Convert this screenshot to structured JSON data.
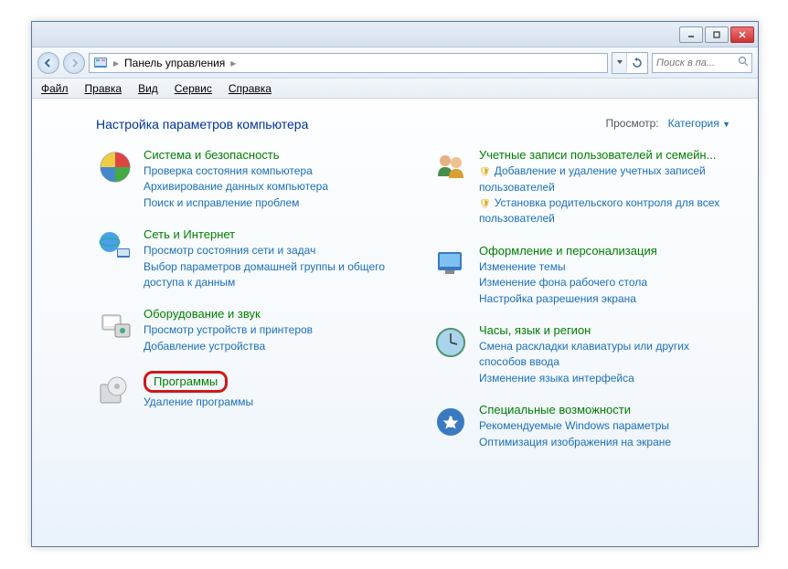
{
  "breadcrumb": {
    "root": "Панель управления"
  },
  "search": {
    "placeholder": "Поиск в па..."
  },
  "menu": {
    "file": "Файл",
    "edit": "Правка",
    "view": "Вид",
    "tools": "Сервис",
    "help": "Справка"
  },
  "heading": "Настройка параметров компьютера",
  "viewby": {
    "label": "Просмотр:",
    "value": "Категория"
  },
  "categories": {
    "left": [
      {
        "id": "system",
        "title": "Система и безопасность",
        "links": [
          {
            "t": "Проверка состояния компьютера"
          },
          {
            "t": "Архивирование данных компьютера"
          },
          {
            "t": "Поиск и исправление проблем"
          }
        ]
      },
      {
        "id": "network",
        "title": "Сеть и Интернет",
        "links": [
          {
            "t": "Просмотр состояния сети и задач"
          },
          {
            "t": "Выбор параметров домашней группы и общего доступа к данным"
          }
        ]
      },
      {
        "id": "hardware",
        "title": "Оборудование и звук",
        "links": [
          {
            "t": "Просмотр устройств и принтеров"
          },
          {
            "t": "Добавление устройства"
          }
        ]
      },
      {
        "id": "programs",
        "title": "Программы",
        "highlighted": true,
        "links": [
          {
            "t": "Удаление программы"
          }
        ]
      }
    ],
    "right": [
      {
        "id": "users",
        "title": "Учетные записи пользователей и семейн...",
        "links": [
          {
            "t": "Добавление и удаление учетных записей пользователей",
            "shield": true
          },
          {
            "t": "Установка родительского контроля для всех пользователей",
            "shield": true
          }
        ]
      },
      {
        "id": "appearance",
        "title": "Оформление и персонализация",
        "links": [
          {
            "t": "Изменение темы"
          },
          {
            "t": "Изменение фона рабочего стола"
          },
          {
            "t": "Настройка разрешения экрана"
          }
        ]
      },
      {
        "id": "clock",
        "title": "Часы, язык и регион",
        "links": [
          {
            "t": "Смена раскладки клавиатуры или других способов ввода"
          },
          {
            "t": "Изменение языка интерфейса"
          }
        ]
      },
      {
        "id": "ease",
        "title": "Специальные возможности",
        "links": [
          {
            "t": "Рекомендуемые Windows параметры"
          },
          {
            "t": "Оптимизация изображения на экране"
          }
        ]
      }
    ]
  }
}
